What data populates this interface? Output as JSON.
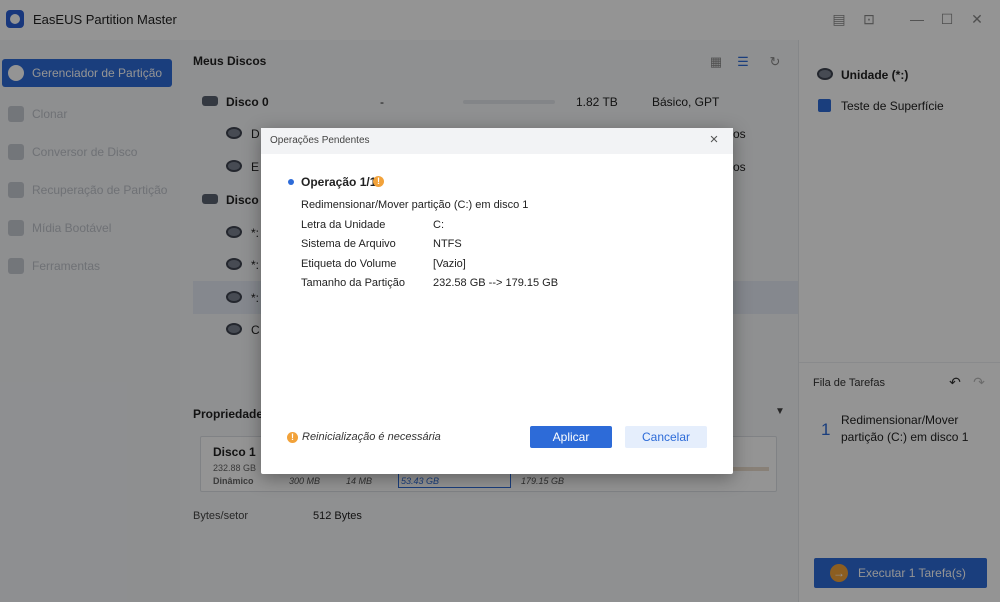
{
  "app": {
    "title": "EasEUS Partition Master"
  },
  "titlebar_icons": [
    "feedback-icon",
    "pin-icon",
    "minimize-icon",
    "maximize-icon",
    "close-icon"
  ],
  "sidebar": {
    "items": [
      {
        "label": "Gerenciador de Partição",
        "icon": "partition-manager-icon",
        "active": true
      },
      {
        "label": "Clonar",
        "icon": "clone-icon"
      },
      {
        "label": "Conversor de Disco",
        "icon": "disk-converter-icon"
      },
      {
        "label": "Recuperação de Partição",
        "icon": "partition-recovery-icon"
      },
      {
        "label": "Mídia Bootável",
        "icon": "bootable-media-icon"
      },
      {
        "label": "Ferramentas",
        "icon": "tools-icon"
      }
    ]
  },
  "main": {
    "title": "Meus Discos",
    "disk0": {
      "name": "Disco 0",
      "fs": "-",
      "size": "1.82 TB",
      "type": "Básico, GPT"
    },
    "disk0_parts": [
      {
        "label": "D",
        "type_tail": "os"
      },
      {
        "label": "E",
        "type_tail": "os"
      }
    ],
    "disk1": {
      "name": "Disco"
    },
    "disk1_parts": [
      {
        "label": "*:"
      },
      {
        "label": "*:"
      },
      {
        "label": "*:"
      },
      {
        "label": "C"
      }
    ],
    "properties": {
      "title": "Propriedades",
      "disk_name": "Disco 1",
      "disk_size": "232.88 GB",
      "disk_type": "Dinâmico",
      "partitions": [
        "300 MB",
        "14 MB",
        "53.43 GB",
        "179.15 GB"
      ],
      "bytes_label": "Bytes/setor",
      "bytes_value": "512 Bytes"
    }
  },
  "right": {
    "drive_label": "Unidade (*:)",
    "surface_test": "Teste de Superfície",
    "queue_title": "Fila de Tarefas",
    "queue_index": "1",
    "queue_item": "Redimensionar/Mover partição (C:) em disco 1",
    "execute_label": "Executar 1 Tarefa(s)",
    "execute_arrow": "→"
  },
  "modal": {
    "title": "Operações Pendentes",
    "close_glyph": "×",
    "operation_title": "Operação 1/1",
    "warn_glyph": "!",
    "description": "Redimensionar/Mover partição (C:) em disco 1",
    "details": [
      {
        "label": "Letra da Unidade",
        "value": "C:"
      },
      {
        "label": "Sistema de Arquivo",
        "value": "NTFS"
      },
      {
        "label": "Etiqueta do Volume",
        "value": "[Vazio]"
      },
      {
        "label": "Tamanho da Partição",
        "value": "232.58 GB --> 179.15 GB"
      }
    ],
    "restart_note": "Reinicialização é necessária",
    "apply_label": "Aplicar",
    "cancel_label": "Cancelar"
  },
  "colors": {
    "accent": "#2d6bd8",
    "warning": "#f2a23a"
  }
}
